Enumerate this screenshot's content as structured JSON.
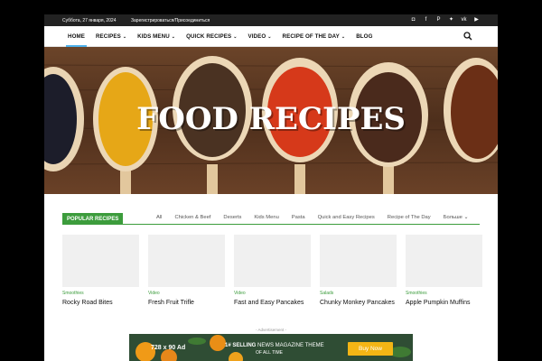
{
  "topbar": {
    "date": "Суббота, 27 января, 2024",
    "login": "Зарегистрироваться/Присоединиться",
    "social_icons": [
      "instagram-icon",
      "facebook-icon",
      "pinterest-icon",
      "twitter-icon",
      "vk-icon",
      "youtube-icon"
    ]
  },
  "nav": {
    "items": [
      {
        "label": "HOME",
        "dropdown": false
      },
      {
        "label": "RECIPES",
        "dropdown": true
      },
      {
        "label": "KIDS MENU",
        "dropdown": true
      },
      {
        "label": "QUICK RECIPES",
        "dropdown": true
      },
      {
        "label": "VIDEO",
        "dropdown": true
      },
      {
        "label": "RECIPE OF THE DAY",
        "dropdown": true
      },
      {
        "label": "BLOG",
        "dropdown": false
      }
    ],
    "search_icon": "search-icon"
  },
  "hero": {
    "title": "FOOD RECIPES"
  },
  "popular": {
    "title": "POPULAR RECIPES",
    "filters": [
      "All",
      "Chicken & Beef",
      "Deserts",
      "Kids Menu",
      "Pasta",
      "Quick and Easy Recipes",
      "Recipe of The Day"
    ],
    "more": "Больше",
    "cards": [
      {
        "category": "Smoothies",
        "title": "Rocky Road Bites"
      },
      {
        "category": "Video",
        "title": "Fresh Fruit Trifle"
      },
      {
        "category": "Video",
        "title": "Fast and Easy Pancakes"
      },
      {
        "category": "Salads",
        "title": "Chunky Monkey Pancakes"
      },
      {
        "category": "Smoothies",
        "title": "Apple Pumpkin Muffins"
      }
    ]
  },
  "ad": {
    "label": "- Advertisement -",
    "size": "728 x 90 Ad",
    "line1_bold": "1# SELLING",
    "line1_rest": " NEWS MAGAZINE THEME",
    "line2": "OF ALL TIME",
    "button": "Buy Now"
  },
  "colors": {
    "accent": "#3c9c3c",
    "nav_active": "#4db2ec",
    "topbar": "#222222",
    "ad_button": "#f3b515"
  }
}
